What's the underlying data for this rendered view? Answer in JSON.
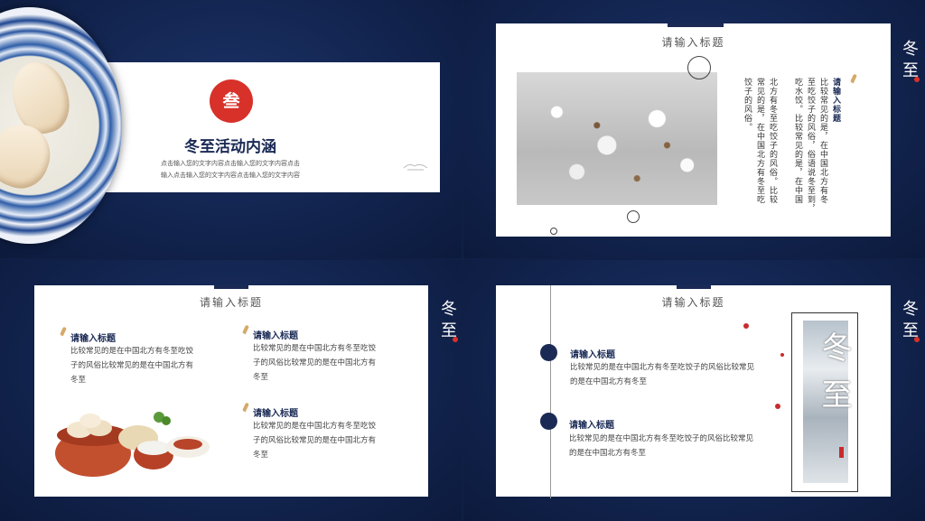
{
  "slide1": {
    "badge": "叁",
    "heading": "冬至活动内涵",
    "body_line1": "点击输入您的文字内容点击输入您的文字内容点击",
    "body_line2": "输入点击输入您的文字内容点击输入您的文字内容"
  },
  "slide2": {
    "title": "请输入标题",
    "item_title": "请输入标题",
    "columns": [
      "比较常见的是，在中国北方有冬",
      "至吃饺子的风俗，俗语说冬至到，",
      "吃水饺。比较常见的是，在中国",
      "北方有冬至吃饺子的风俗。比较",
      "常见的是，在中国北方有冬至吃",
      "饺子的风俗。"
    ],
    "brand": "冬至"
  },
  "slide3": {
    "title": "请输入标题",
    "items": [
      {
        "title": "请输入标题",
        "lines": [
          "比较常见的是在中国北方有冬至吃饺",
          "子的风俗比较常见的是在中国北方有",
          "冬至"
        ]
      },
      {
        "title": "请输入标题",
        "lines": [
          "比较常见的是在中国北方有冬至吃饺",
          "子的风俗比较常见的是在中国北方有",
          "冬至"
        ]
      },
      {
        "title": "请输入标题",
        "lines": [
          "比较常见的是在中国北方有冬至吃饺",
          "子的风俗比较常见的是在中国北方有",
          "冬至"
        ]
      }
    ],
    "brand": "冬至"
  },
  "slide4": {
    "title": "请输入标题",
    "items": [
      {
        "title": "请输入标题",
        "lines": [
          "比较常见的是在中国北方有冬至吃饺子的风俗比较常见",
          "的是在中国北方有冬至"
        ]
      },
      {
        "title": "请输入标题",
        "lines": [
          "比较常见的是在中国北方有冬至吃饺子的风俗比较常见",
          "的是在中国北方有冬至"
        ]
      }
    ],
    "poster_text": "冬至",
    "brand": "冬至"
  },
  "colors": {
    "navy": "#1b2a55",
    "accent_red": "#d8312a"
  }
}
